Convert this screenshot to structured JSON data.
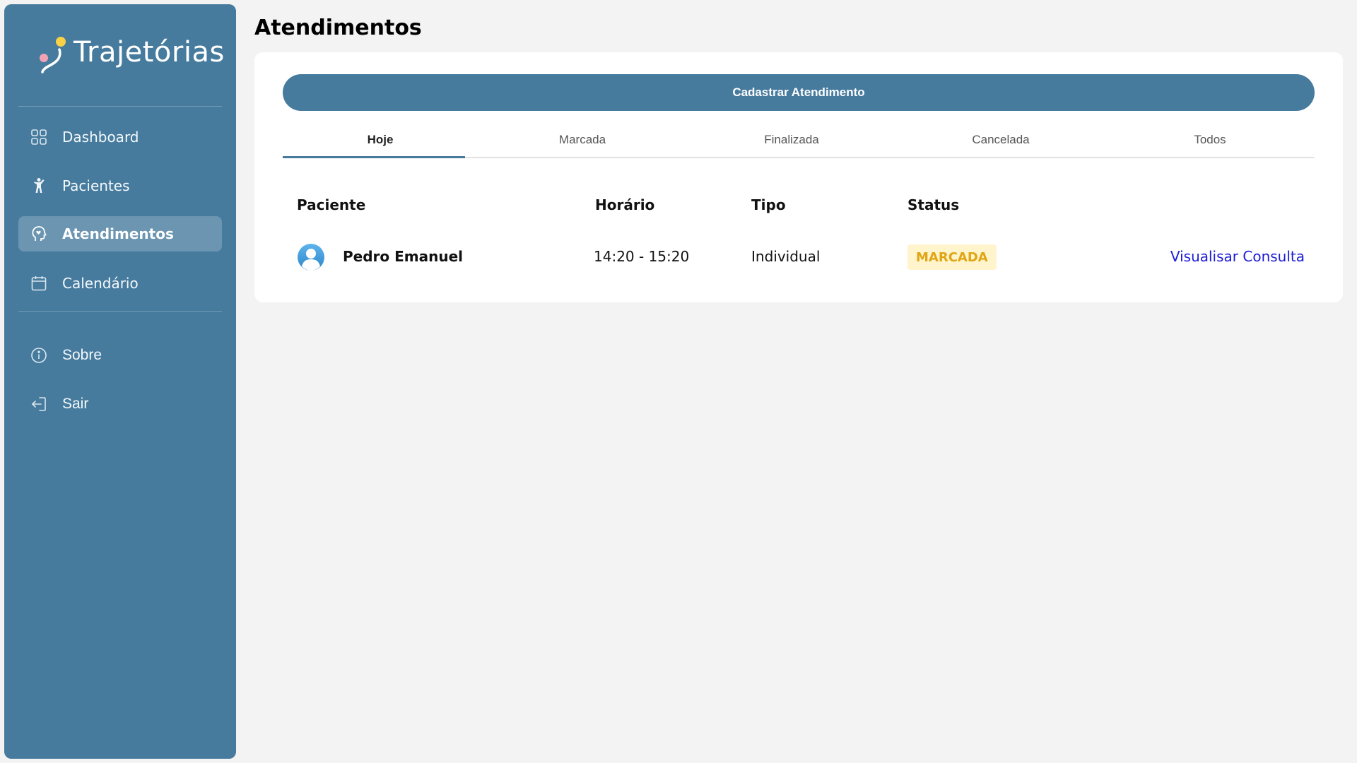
{
  "app": {
    "name": "Trajetórias"
  },
  "sidebar": {
    "items": [
      {
        "label": "Dashboard",
        "icon": "grid-icon"
      },
      {
        "label": "Pacientes",
        "icon": "person-icon"
      },
      {
        "label": "Atendimentos",
        "icon": "head-heart-icon",
        "active": true
      },
      {
        "label": "Calendário",
        "icon": "calendar-icon"
      }
    ],
    "secondary": [
      {
        "label": "Sobre",
        "icon": "info-icon"
      },
      {
        "label": "Sair",
        "icon": "logout-icon"
      }
    ]
  },
  "page": {
    "title": "Atendimentos"
  },
  "actions": {
    "create_label": "Cadastrar Atendimento"
  },
  "tabs": [
    {
      "label": "Hoje",
      "active": true
    },
    {
      "label": "Marcada"
    },
    {
      "label": "Finalizada"
    },
    {
      "label": "Cancelada"
    },
    {
      "label": "Todos"
    }
  ],
  "table": {
    "columns": [
      "Paciente",
      "Horário",
      "Tipo",
      "Status"
    ],
    "rows": [
      {
        "patient": "Pedro Emanuel",
        "time": "14:20 - 15:20",
        "type": "Individual",
        "status": "MARCADA",
        "action": "Visualisar Consulta"
      }
    ]
  },
  "colors": {
    "brand": "#467b9e",
    "status_pending_bg": "#fff4cc",
    "status_pending_text": "#e0a514",
    "link": "#1b1bd6"
  }
}
